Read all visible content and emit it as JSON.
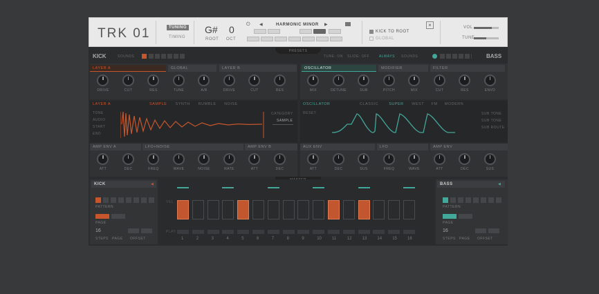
{
  "colors": {
    "orange": "#c8562d",
    "teal": "#42a89a",
    "bg": "#2b2c2e",
    "topbar": "#e9e9e9"
  },
  "header": {
    "logo": "TRK 01",
    "tab_tuning": "TUNING",
    "tab_timing": "TIMING",
    "root_note": "G#",
    "root_label": "ROOT",
    "octave": "0",
    "oct_label": "OCT",
    "scale": "HARMONIC MINOR",
    "kick_to_root": "KICK TO ROOT",
    "global": "GLOBAL",
    "vol": "VOL",
    "tune": "TUNE"
  },
  "mid": {
    "kick": "KICK",
    "sounds": "SOUNDS",
    "presets": "PRESETS",
    "tune_lbl": "TUNE: ON",
    "slide_lbl": "SLIDE: OFF",
    "always": "ALWAYS",
    "sounds2": "SOUNDS",
    "bass": "BASS",
    "master": "MASTER"
  },
  "kick_panel": {
    "layer_a": "LAYER A",
    "global": "GLOBAL",
    "layer_b": "LAYER B",
    "knobs": [
      "DRIVE",
      "CUT",
      "RES",
      "TUNE",
      "A/B",
      "DRIVE",
      "CUT",
      "RES"
    ],
    "tabs": [
      "LAYER A",
      "SAMPLE",
      "SYNTH",
      "RUMBLE",
      "NOISE"
    ],
    "side": [
      "TONE",
      "AUDIO",
      "START",
      "END"
    ],
    "category": "CATEGORY",
    "sample": "SAMPLE",
    "env_a": "AMP ENV A",
    "lfo_noise": "LFO+NOISE",
    "env_b": "AMP ENV B",
    "env_knobs": [
      "ATT",
      "DEC",
      "FREQ",
      "WAVE",
      "NOISE",
      "RATE",
      "ATT",
      "DEC"
    ]
  },
  "bass_panel": {
    "oscillator": "OSCILLATOR",
    "modifier": "MODIFIER",
    "filter": "FILTER",
    "knobs": [
      "MIX",
      "DETUNE",
      "SUB",
      "PITCH",
      "MIX",
      "CUT",
      "RES",
      "ENVD"
    ],
    "tabs": [
      "OSCILLATOR",
      "CLASSIC",
      "SUPER",
      "WEST",
      "FM",
      "MODERN"
    ],
    "reset": "RESET",
    "subs": [
      "SUB TONE",
      "SUB TONE",
      "SUB ROUTE"
    ],
    "aux_env": "AUX ENV",
    "lfo": "LFO",
    "amp_env": "AMP ENV",
    "env_knobs": [
      "ATT",
      "DEC",
      "SUS",
      "FREQ",
      "WAVE",
      "ATT",
      "DEC",
      "SUS"
    ]
  },
  "seq": {
    "kick_title": "KICK",
    "bass_title": "BASS",
    "pattern": "PATTERN",
    "page": "PAGE",
    "steps": "STEPS",
    "page2": "PAGE",
    "offset": "OFFSET",
    "steps_val": "16",
    "steps_nums": [
      "1",
      "2",
      "3",
      "4",
      "5",
      "6",
      "7",
      "8",
      "9",
      "10",
      "11",
      "12",
      "13",
      "14",
      "15",
      "16"
    ],
    "active_steps": [
      0,
      4,
      10,
      12
    ],
    "vel": "VEL",
    "play": "PLAY"
  }
}
